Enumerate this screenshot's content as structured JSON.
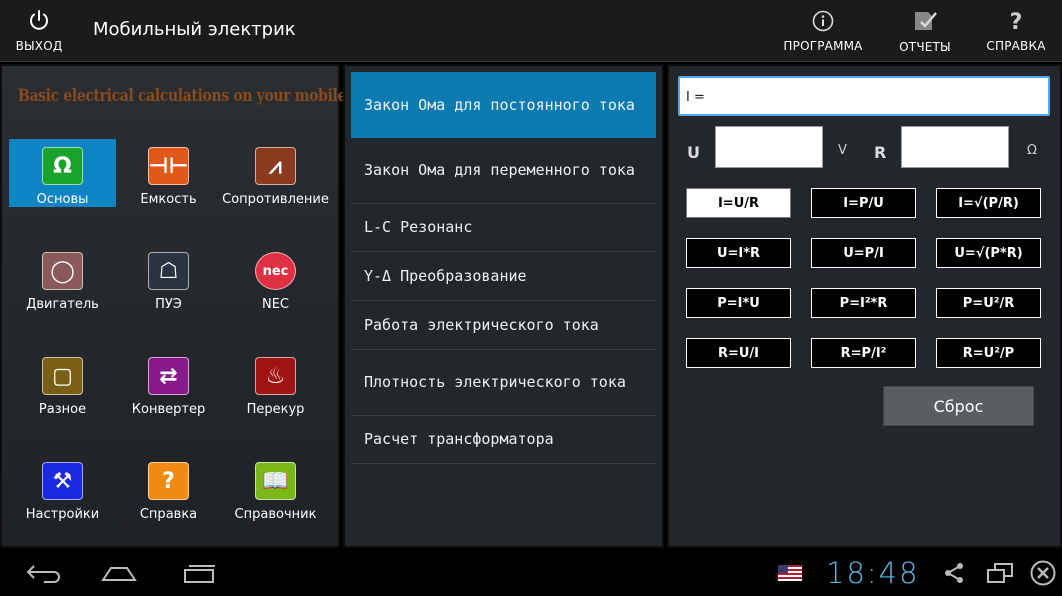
{
  "app": {
    "title": "Мобильный электрик",
    "exit_label": "ВЫХОД",
    "actions": [
      {
        "label": "ПРОГРАММА",
        "icon": "info-icon"
      },
      {
        "label": "ОТЧЕТЫ",
        "icon": "reports-icon"
      },
      {
        "label": "СПРАВКА",
        "icon": "help-icon"
      }
    ]
  },
  "left": {
    "banner": "Basic electrical calculations on your mobile phone",
    "items": [
      {
        "label": "Основы",
        "glyph": "Ω",
        "color": "#1aa32a",
        "icon": "omega-icon"
      },
      {
        "label": "Емкость",
        "glyph": "⊣⊢",
        "color": "#e0581a",
        "icon": "capacitor-icon"
      },
      {
        "label": "Сопротивление",
        "glyph": "⩘",
        "color": "#8a3a1e",
        "icon": "resistor-icon"
      },
      {
        "label": "Двигатель",
        "glyph": "◯",
        "color": "#8a5a5a",
        "icon": "motor-icon"
      },
      {
        "label": "ПУЭ",
        "glyph": "☖",
        "color": "#2a3440",
        "icon": "book-reader-icon"
      },
      {
        "label": "NEC",
        "glyph": "nec",
        "color": "#e03044",
        "icon": "nec-icon"
      },
      {
        "label": "Разное",
        "glyph": "▢",
        "color": "#7a6014",
        "icon": "misc-icon"
      },
      {
        "label": "Конвертер",
        "glyph": "⇄",
        "color": "#8a1a8a",
        "icon": "converter-icon"
      },
      {
        "label": "Перекур",
        "glyph": "♨",
        "color": "#a01414",
        "icon": "smoke-break-icon"
      },
      {
        "label": "Настройки",
        "glyph": "⚒",
        "color": "#1a2ae0",
        "icon": "settings-tools-icon"
      },
      {
        "label": "Справка",
        "glyph": "?",
        "color": "#f08a10",
        "icon": "help-question-icon"
      },
      {
        "label": "Справочник",
        "glyph": "📖",
        "color": "#7ab81a",
        "icon": "handbook-icon"
      }
    ]
  },
  "middle": {
    "items": [
      {
        "label": "Закон Ома для постоянного тока"
      },
      {
        "label": "Закон Ома для переменного тока"
      },
      {
        "label": "L-C Резонанс"
      },
      {
        "label": "Y-Δ Преобразование"
      },
      {
        "label": "Работа электрического тока"
      },
      {
        "label": "Плотность электрического тока"
      },
      {
        "label": "Расчет трансформатора"
      }
    ]
  },
  "right": {
    "result": "I =",
    "u_label": "U",
    "u_unit": "V",
    "r_label": "R",
    "r_unit": "Ω",
    "u_value": "",
    "r_value": "",
    "formulas": [
      [
        "I=U/R",
        "I=P/U",
        "I=√(P/R)"
      ],
      [
        "U=I*R",
        "U=P/I",
        "U=√(P*R)"
      ],
      [
        "P=I*U",
        "P=I²*R",
        "P=U²/R"
      ],
      [
        "R=U/I",
        "R=P/I²",
        "R=U²/P"
      ]
    ],
    "reset_label": "Сброс"
  },
  "status": {
    "time": "18:48",
    "flag": "us-flag-icon"
  },
  "colors": {
    "accent": "#0f84c4",
    "list_active": "#0b7ab0",
    "clock": "#5fb7e6",
    "banner": "#8b4a1a"
  }
}
